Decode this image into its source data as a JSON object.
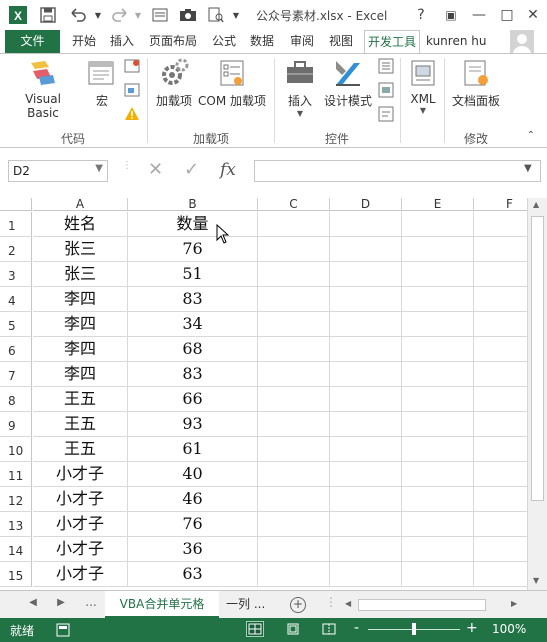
{
  "app": {
    "title": "公众号素材.xlsx - Excel",
    "window_buttons": [
      "?",
      "▣",
      "—",
      "□",
      "✕"
    ]
  },
  "ribbon_tabs": [
    "文件",
    "开始",
    "插入",
    "页面布局",
    "公式",
    "数据",
    "审阅",
    "视图",
    "开发工具"
  ],
  "user_name": "kunren hu",
  "ribbon": {
    "code_group": {
      "label": "代码",
      "visual_basic": "Visual Basic",
      "macro": "宏"
    },
    "addins_group": {
      "label": "加载项",
      "addins": "加载项",
      "com_addins": "COM 加载项"
    },
    "controls_group": {
      "label": "控件",
      "insert": "插入",
      "design_mode": "设计模式"
    },
    "xml_group": {
      "xml": "XML"
    },
    "modify_group": {
      "label": "修改",
      "doc_panel": "文档面板"
    }
  },
  "formula_bar": {
    "name_box": "D2",
    "fx": "fx",
    "formula": ""
  },
  "columns": [
    "A",
    "B",
    "C",
    "D",
    "E",
    "F"
  ],
  "rows": [
    {
      "n": "1",
      "a": "姓名",
      "b": "数量"
    },
    {
      "n": "2",
      "a": "张三",
      "b": "76"
    },
    {
      "n": "3",
      "a": "张三",
      "b": "51"
    },
    {
      "n": "4",
      "a": "李四",
      "b": "83"
    },
    {
      "n": "5",
      "a": "李四",
      "b": "34"
    },
    {
      "n": "6",
      "a": "李四",
      "b": "68"
    },
    {
      "n": "7",
      "a": "李四",
      "b": "83"
    },
    {
      "n": "8",
      "a": "王五",
      "b": "66"
    },
    {
      "n": "9",
      "a": "王五",
      "b": "93"
    },
    {
      "n": "10",
      "a": "王五",
      "b": "61"
    },
    {
      "n": "11",
      "a": "小才子",
      "b": "40"
    },
    {
      "n": "12",
      "a": "小才子",
      "b": "46"
    },
    {
      "n": "13",
      "a": "小才子",
      "b": "76"
    },
    {
      "n": "14",
      "a": "小才子",
      "b": "36"
    },
    {
      "n": "15",
      "a": "小才子",
      "b": "63"
    }
  ],
  "sheets": {
    "ellipsis": "...",
    "active": "VBA合并单元格",
    "next": "一列 ...",
    "add": "+"
  },
  "status": {
    "ready": "就绪",
    "zoom": "100%",
    "minus": "-",
    "plus": "+"
  },
  "colors": {
    "accent": "#217346",
    "grid": "#d9d9d9"
  }
}
